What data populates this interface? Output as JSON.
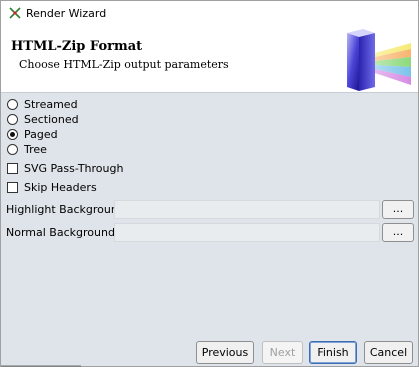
{
  "window": {
    "title": "Render Wizard"
  },
  "header": {
    "title": "HTML-Zip Format",
    "subtitle": "Choose HTML-Zip output parameters"
  },
  "layout_options": [
    {
      "label": "Streamed",
      "checked": false
    },
    {
      "label": "Sectioned",
      "checked": false
    },
    {
      "label": "Paged",
      "checked": true
    },
    {
      "label": "Tree",
      "checked": false
    }
  ],
  "checkboxes": [
    {
      "label": "SVG Pass-Through",
      "checked": false
    },
    {
      "label": "Skip Headers",
      "checked": false
    }
  ],
  "fields": [
    {
      "label": "Highlight Background:",
      "value": "",
      "button": "..."
    },
    {
      "label": "Normal Background:",
      "value": "",
      "button": "..."
    }
  ],
  "buttons": {
    "previous": "Previous",
    "next": "Next",
    "finish": "Finish",
    "cancel": "Cancel"
  }
}
